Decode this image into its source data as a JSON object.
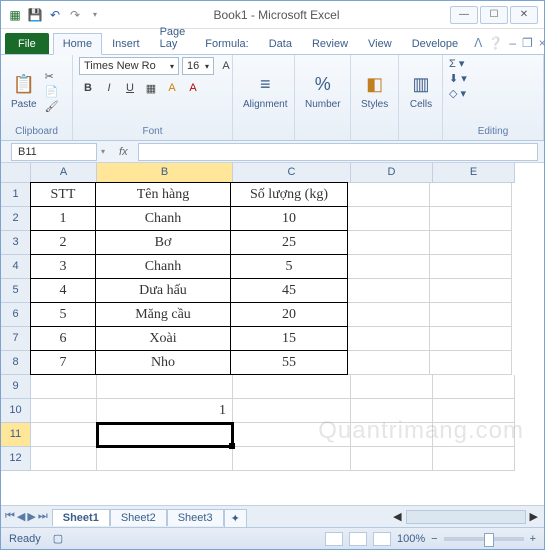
{
  "titlebar": {
    "title": "Book1 - Microsoft Excel"
  },
  "tabs": {
    "file": "File",
    "home": "Home",
    "insert": "Insert",
    "pagelay": "Page Lay",
    "formula": "Formula:",
    "data": "Data",
    "review": "Review",
    "view": "View",
    "developer": "Develope"
  },
  "ribbon": {
    "clipboard": {
      "paste": "Paste",
      "label": "Clipboard"
    },
    "font": {
      "name": "Times New Ro",
      "size": "16",
      "label": "Font"
    },
    "alignment": {
      "btn": "Alignment"
    },
    "number": {
      "btn": "Number"
    },
    "styles": {
      "btn": "Styles"
    },
    "cells": {
      "btn": "Cells"
    },
    "editing": {
      "label": "Editing"
    }
  },
  "namebox": "B11",
  "fx": "fx",
  "columns": [
    "A",
    "B",
    "C",
    "D",
    "E"
  ],
  "rowNums": [
    "1",
    "2",
    "3",
    "4",
    "5",
    "6",
    "7",
    "8",
    "9",
    "10",
    "11",
    "12"
  ],
  "table": {
    "header": {
      "a": "STT",
      "b": "Tên hàng",
      "c": "Số lượng (kg)"
    },
    "rows": [
      {
        "a": "1",
        "b": "Chanh",
        "c": "10"
      },
      {
        "a": "2",
        "b": "Bơ",
        "c": "25"
      },
      {
        "a": "3",
        "b": "Chanh",
        "c": "5"
      },
      {
        "a": "4",
        "b": "Dưa hấu",
        "c": "45"
      },
      {
        "a": "5",
        "b": "Măng cầu",
        "c": "20"
      },
      {
        "a": "6",
        "b": "Xoài",
        "c": "15"
      },
      {
        "a": "7",
        "b": "Nho",
        "c": "55"
      }
    ]
  },
  "b10": "1",
  "sheets": {
    "s1": "Sheet1",
    "s2": "Sheet2",
    "s3": "Sheet3"
  },
  "status": {
    "ready": "Ready",
    "zoom": "100%"
  },
  "watermark": "Quantrimang.com"
}
